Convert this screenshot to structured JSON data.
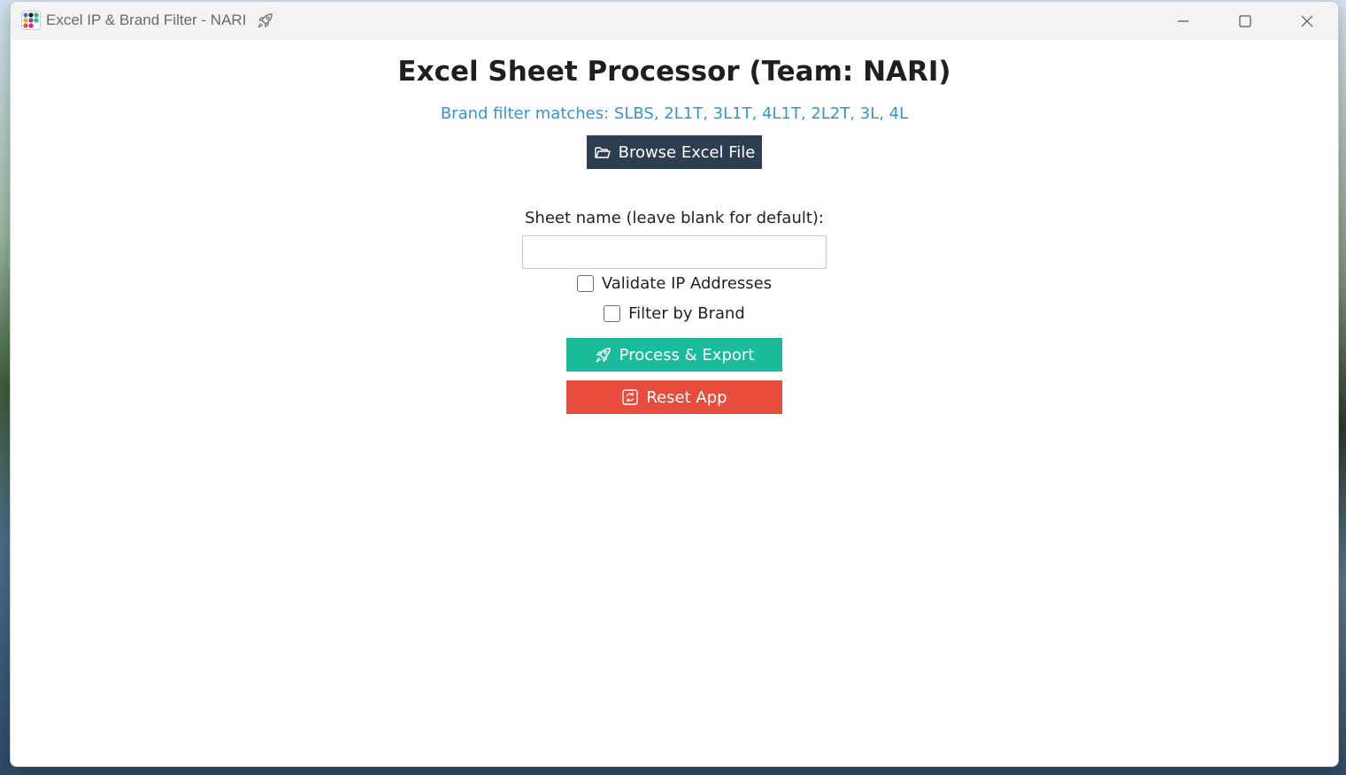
{
  "window": {
    "title": "Excel IP & Brand Filter - NARI",
    "title_icon": "rocket-icon",
    "app_icon": "app-dots-icon",
    "controls": {
      "minimize_icon": "minimize-icon",
      "maximize_icon": "maximize-icon",
      "close_icon": "close-icon"
    }
  },
  "main": {
    "heading": "Excel Sheet Processor (Team: NARI)",
    "brand_info": "Brand filter matches: SLBS, 2L1T, 3L1T, 4L1T, 2L2T, 3L, 4L",
    "browse_button": {
      "label": "Browse Excel File",
      "icon": "folder-open-icon"
    },
    "sheet_name": {
      "label": "Sheet name (leave blank for default):",
      "value": "",
      "placeholder": ""
    },
    "validate_ip": {
      "label": "Validate IP Addresses",
      "checked": false
    },
    "filter_brand": {
      "label": "Filter by Brand",
      "checked": false
    },
    "process_button": {
      "label": "Process & Export",
      "icon": "rocket-icon"
    },
    "reset_button": {
      "label": "Reset App",
      "icon": "refresh-icon"
    }
  },
  "colors": {
    "browse_bg": "#2c3e50",
    "process_bg": "#1abc9c",
    "reset_bg": "#e74c3c",
    "info_text": "#3a93cf"
  }
}
